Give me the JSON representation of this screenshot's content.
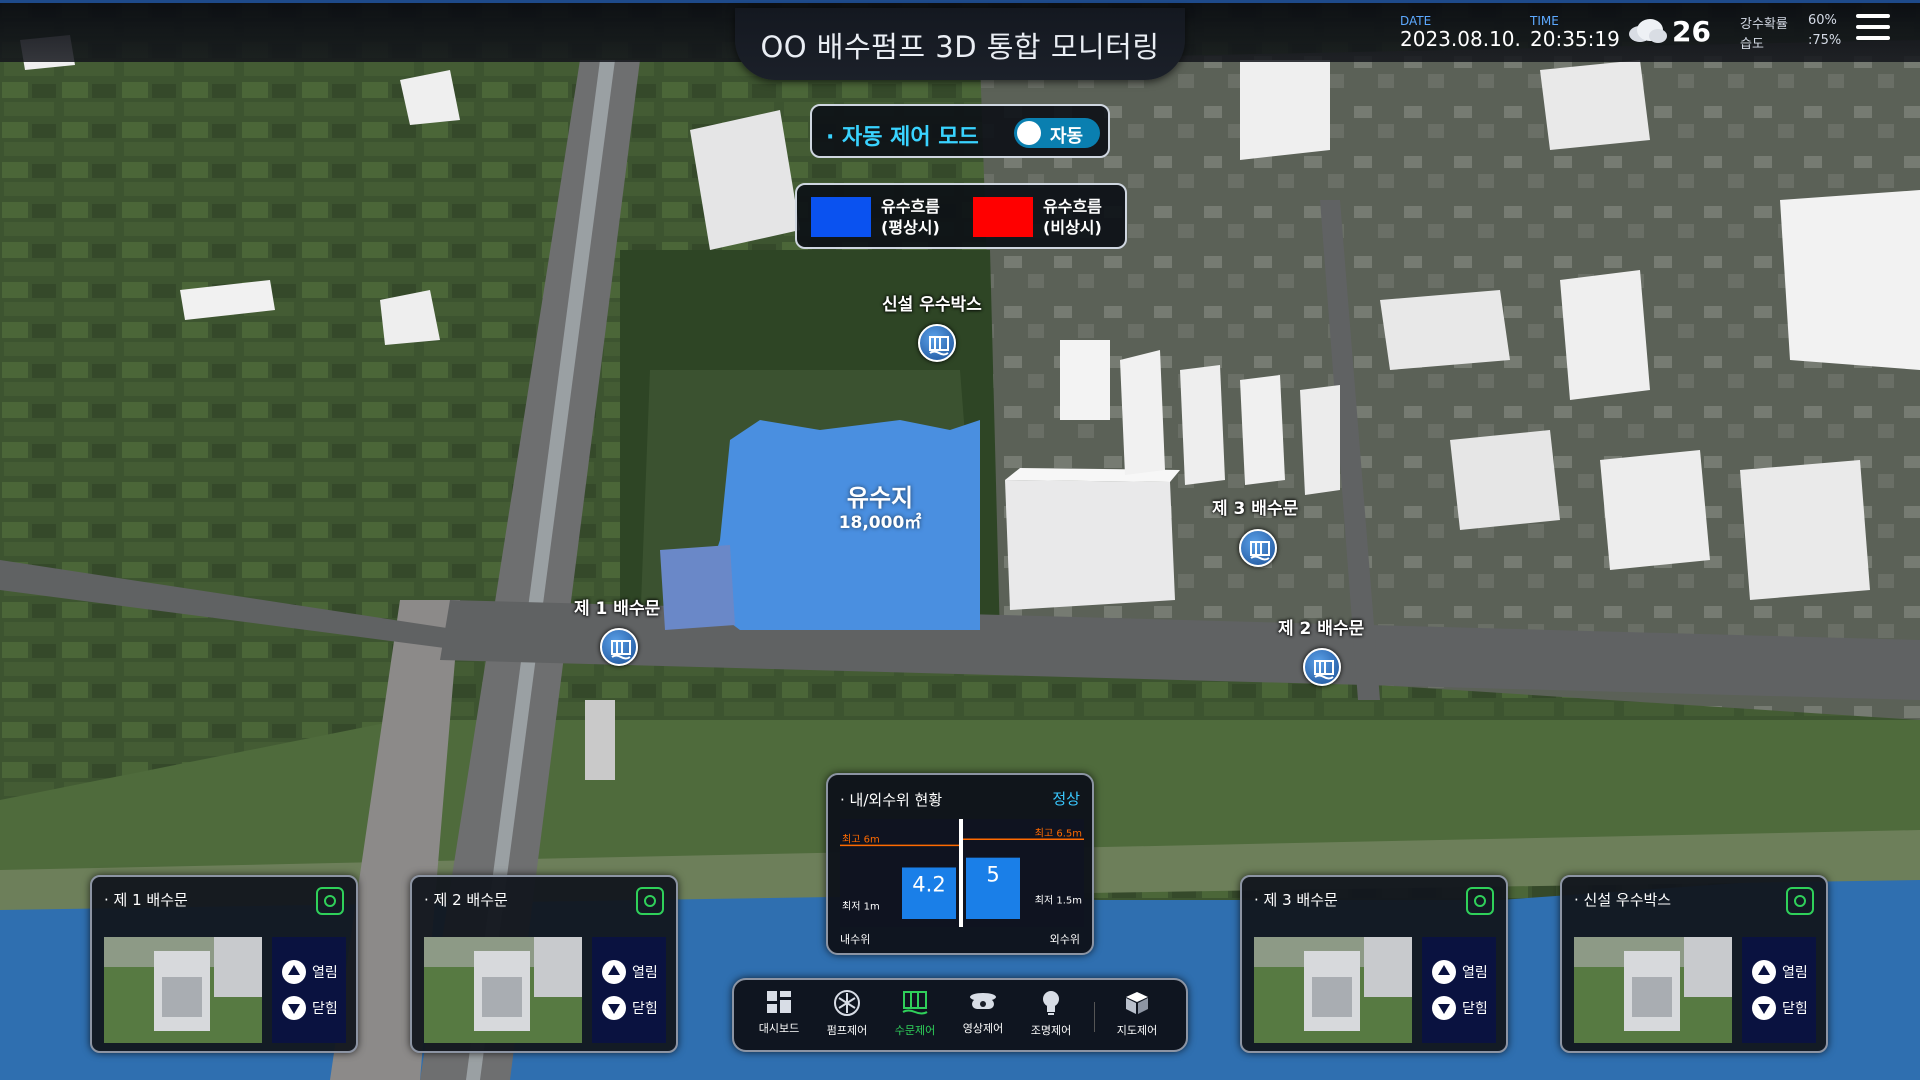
{
  "header": {
    "title": "OO 배수펌프 3D 통합 모니터링",
    "date_label": "DATE",
    "date_value": "2023.08.10.",
    "time_label": "TIME",
    "time_value": "20:35:19",
    "weather_icon": "cloud-icon",
    "temperature": "26",
    "rain_prob_label": "강수확률",
    "rain_prob_value": "60%",
    "humidity_label": "습도",
    "humidity_value": ":75%",
    "menu_icon": "hamburger-menu-icon"
  },
  "mode": {
    "label": "· 자동 제어 모드",
    "toggle_text": "자동",
    "toggle_on": true
  },
  "legend": {
    "items": [
      {
        "color": "#0a52f0",
        "text_line1": "유수흐름",
        "text_line2": "(평상시)"
      },
      {
        "color": "#ff0000",
        "text_line1": "유수흐름",
        "text_line2": "(비상시)"
      }
    ]
  },
  "map": {
    "pond": {
      "name": "유수지",
      "area": "18,000㎡"
    },
    "markers": [
      {
        "label": "신설 우수박스"
      },
      {
        "label": "제 3 배수문"
      },
      {
        "label": "제 1 배수문"
      },
      {
        "label": "제 2 배수문"
      }
    ]
  },
  "gates": [
    {
      "title": "· 제 1 배수문",
      "open_label": "열림",
      "close_label": "닫힘"
    },
    {
      "title": "· 제 2 배수문",
      "open_label": "열림",
      "close_label": "닫힘"
    },
    {
      "title": "· 제 3 배수문",
      "open_label": "열림",
      "close_label": "닫힘"
    },
    {
      "title": "· 신설 우수박스",
      "open_label": "열림",
      "close_label": "닫힘"
    }
  ],
  "water_level": {
    "title": "· 내/외수위 현황",
    "status": "정상",
    "inner": {
      "label": "내수위",
      "value": 4.2,
      "max_label": "최고 6m",
      "min_label": "최저 1m",
      "max": 6,
      "min": 1
    },
    "outer": {
      "label": "외수위",
      "value": 5,
      "max_label": "최고 6.5m",
      "min_label": "최저 1.5m",
      "max": 6.5,
      "min": 1.5
    },
    "accent_color": "#ff6a00",
    "bar_color": "#1a7fe8"
  },
  "nav": {
    "items": [
      {
        "label": "대시보드",
        "icon": "dashboard-icon",
        "active": false
      },
      {
        "label": "펌프제어",
        "icon": "pump-fan-icon",
        "active": false
      },
      {
        "label": "수문제어",
        "icon": "sluice-gate-icon",
        "active": true
      },
      {
        "label": "영상제어",
        "icon": "cctv-camera-icon",
        "active": false
      },
      {
        "label": "조명제어",
        "icon": "light-bulb-icon",
        "active": false
      },
      {
        "label": "지도제어",
        "icon": "map-cube-icon",
        "active": false
      }
    ],
    "active_color": "#2fd05a"
  }
}
